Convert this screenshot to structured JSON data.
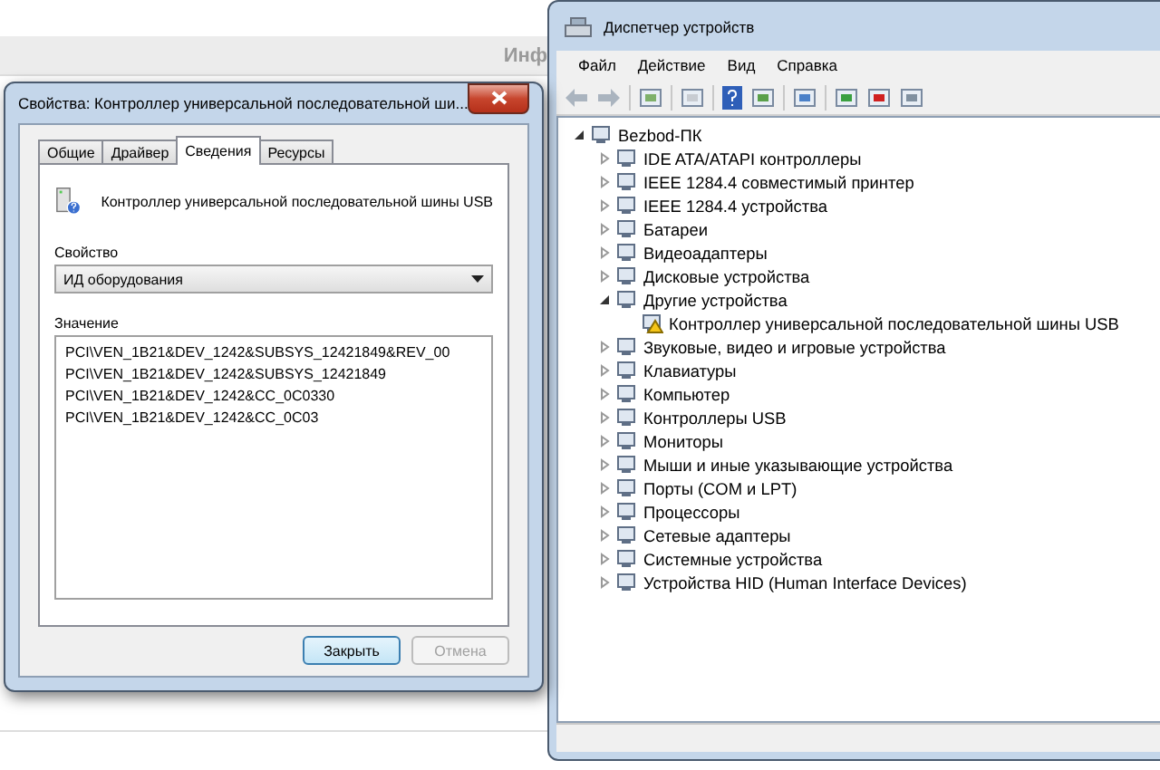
{
  "background_page": {
    "header_text": "Инф"
  },
  "properties_dialog": {
    "title": "Свойства: Контроллер универсальной последовательной ши...",
    "tabs": [
      {
        "label": "Общие",
        "selected": false
      },
      {
        "label": "Драйвер",
        "selected": false
      },
      {
        "label": "Сведения",
        "selected": true
      },
      {
        "label": "Ресурсы",
        "selected": false
      }
    ],
    "device_name": "Контроллер универсальной последовательной шины USB",
    "property_label": "Свойство",
    "property_value": "ИД оборудования",
    "value_label": "Значение",
    "values": [
      "PCI\\VEN_1B21&DEV_1242&SUBSYS_12421849&REV_00",
      "PCI\\VEN_1B21&DEV_1242&SUBSYS_12421849",
      "PCI\\VEN_1B21&DEV_1242&CC_0C0330",
      "PCI\\VEN_1B21&DEV_1242&CC_0C03"
    ],
    "buttons": [
      {
        "label": "Закрыть",
        "disabled": false
      },
      {
        "label": "Отмена",
        "disabled": true
      }
    ]
  },
  "device_manager": {
    "title": "Диспетчер устройств",
    "menu": [
      "Файл",
      "Действие",
      "Вид",
      "Справка"
    ],
    "tree": [
      {
        "label": "Bezbod-ПК",
        "expanded": true,
        "warning": false,
        "children": [
          {
            "label": "IDE ATA/ATAPI контроллеры",
            "expanded": false,
            "warning": false
          },
          {
            "label": "IEEE 1284.4 совместимый принтер",
            "expanded": false,
            "warning": false
          },
          {
            "label": "IEEE 1284.4 устройства",
            "expanded": false,
            "warning": false
          },
          {
            "label": "Батареи",
            "expanded": false,
            "warning": false
          },
          {
            "label": "Видеоадаптеры",
            "expanded": false,
            "warning": false
          },
          {
            "label": "Дисковые устройства",
            "expanded": false,
            "warning": false
          },
          {
            "label": "Другие устройства",
            "expanded": true,
            "warning": false,
            "children": [
              {
                "label": "Контроллер универсальной последовательной шины USB",
                "warning": true
              }
            ]
          },
          {
            "label": "Звуковые, видео и игровые устройства",
            "expanded": false,
            "warning": false
          },
          {
            "label": "Клавиатуры",
            "expanded": false,
            "warning": false
          },
          {
            "label": "Компьютер",
            "expanded": false,
            "warning": false
          },
          {
            "label": "Контроллеры USB",
            "expanded": false,
            "warning": false
          },
          {
            "label": "Мониторы",
            "expanded": false,
            "warning": false
          },
          {
            "label": "Мыши и иные указывающие устройства",
            "expanded": false,
            "warning": false
          },
          {
            "label": "Порты (COM и LPT)",
            "expanded": false,
            "warning": false
          },
          {
            "label": "Процессоры",
            "expanded": false,
            "warning": false
          },
          {
            "label": "Сетевые адаптеры",
            "expanded": false,
            "warning": false
          },
          {
            "label": "Системные устройства",
            "expanded": false,
            "warning": false
          },
          {
            "label": "Устройства HID (Human Interface Devices)",
            "expanded": false,
            "warning": false
          }
        ]
      }
    ]
  }
}
